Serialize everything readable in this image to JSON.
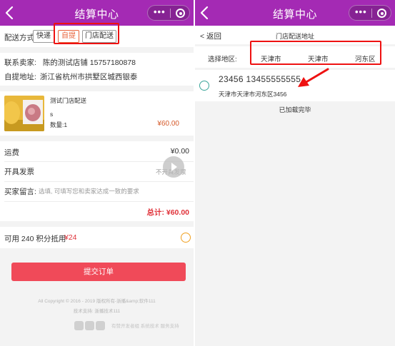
{
  "left": {
    "nav": {
      "title": "结算中心",
      "menu_dots": "•••"
    },
    "delivery": {
      "label": "配送方式",
      "options": [
        "快递",
        "自提",
        "门店配送"
      ],
      "selected": "自提"
    },
    "seller": {
      "label": "联系卖家:",
      "name_phone": "陈的测试店铺 15757180878",
      "address_label": "自提地址:",
      "address": "浙江省杭州市拱墅区城西银泰"
    },
    "product": {
      "name": "测试门店配送",
      "sku": "s",
      "quantity": "数量:1",
      "price": "¥60.00"
    },
    "freight": {
      "label": "运费",
      "value": "¥0.00"
    },
    "invoice": {
      "label": "开具发票",
      "value": "不开具发票"
    },
    "message": {
      "label": "买家留言:",
      "placeholder": "选填, 可填写您和卖家达成一致的要求"
    },
    "total": "总计: ¥60.00",
    "points": {
      "text": "可用 240 积分抵用",
      "amount": "¥24"
    },
    "submit_label": "提交订单",
    "footer_copyright": "All Copyright © 2016 - 2019 版权所有-浙播&amp;软件111",
    "footer_support": "技术支持: 浙播技术111",
    "footer_logo_text": "有赞开发者组 系统技术 服务支持"
  },
  "right": {
    "nav": {
      "title": "结算中心",
      "menu_dots": "•••"
    },
    "back_label": "< 返回",
    "header_title": "门店配送地址",
    "region": {
      "label": "选择地区:",
      "options": [
        "天津市",
        "天津市",
        "河东区"
      ]
    },
    "address_item": {
      "name_phone": "23456  13455555555",
      "full_address": "天津市天津市河东区3456"
    },
    "status_text": "已加载完毕"
  },
  "colors": {
    "nav_bg": "#a42ab4",
    "accent_red": "#e11111",
    "price_orange": "#d55a2a",
    "submit_bg": "#f04a59",
    "radio_teal": "#3aa59a",
    "radio_orange": "#f0a020"
  }
}
